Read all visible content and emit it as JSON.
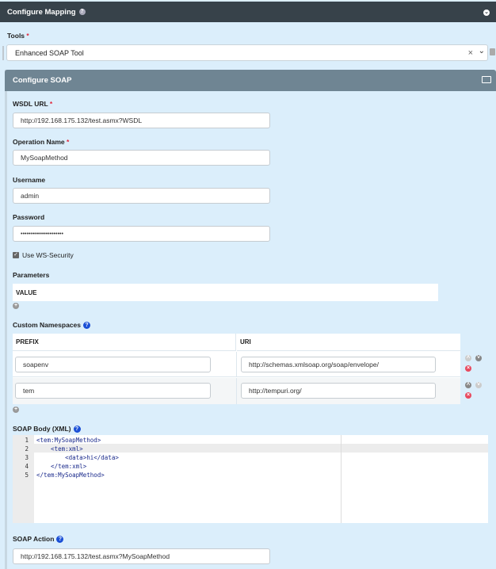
{
  "header": {
    "title": "Configure Mapping"
  },
  "tools": {
    "label": "Tools",
    "required": "*",
    "value": "Enhanced SOAP Tool",
    "clear": "×",
    "chevron": "⌄"
  },
  "soap": {
    "title": "Configure SOAP",
    "wsdl": {
      "label": "WSDL URL",
      "value": "http://192.168.175.132/test.asmx?WSDL"
    },
    "operation": {
      "label": "Operation Name",
      "value": "MySoapMethod"
    },
    "username": {
      "label": "Username",
      "value": "admin"
    },
    "password": {
      "label": "Password",
      "value": "••••••••••••••••••••••"
    },
    "ws_security": {
      "label": "Use WS-Security",
      "checked": true
    },
    "parameters": {
      "label": "Parameters",
      "column": "VALUE"
    },
    "namespaces": {
      "label": "Custom Namespaces",
      "columns": [
        "PREFIX",
        "URI"
      ],
      "rows": [
        {
          "prefix": "soapenv",
          "uri": "http://schemas.xmlsoap.org/soap/envelope/"
        },
        {
          "prefix": "tem",
          "uri": "http://tempuri.org/"
        }
      ]
    },
    "body": {
      "label": "SOAP Body (XML)",
      "lines": [
        {
          "n": "1",
          "code": "<tem:MySoapMethod>"
        },
        {
          "n": "2",
          "code": "    <tem:xml>"
        },
        {
          "n": "3",
          "code": "        <data>hi</data>"
        },
        {
          "n": "4",
          "code": "    </tem:xml>"
        },
        {
          "n": "5",
          "code": "</tem:MySoapMethod>"
        }
      ]
    },
    "action": {
      "label": "SOAP Action",
      "value": "http://192.168.175.132/test.asmx?MySoapMethod"
    }
  }
}
